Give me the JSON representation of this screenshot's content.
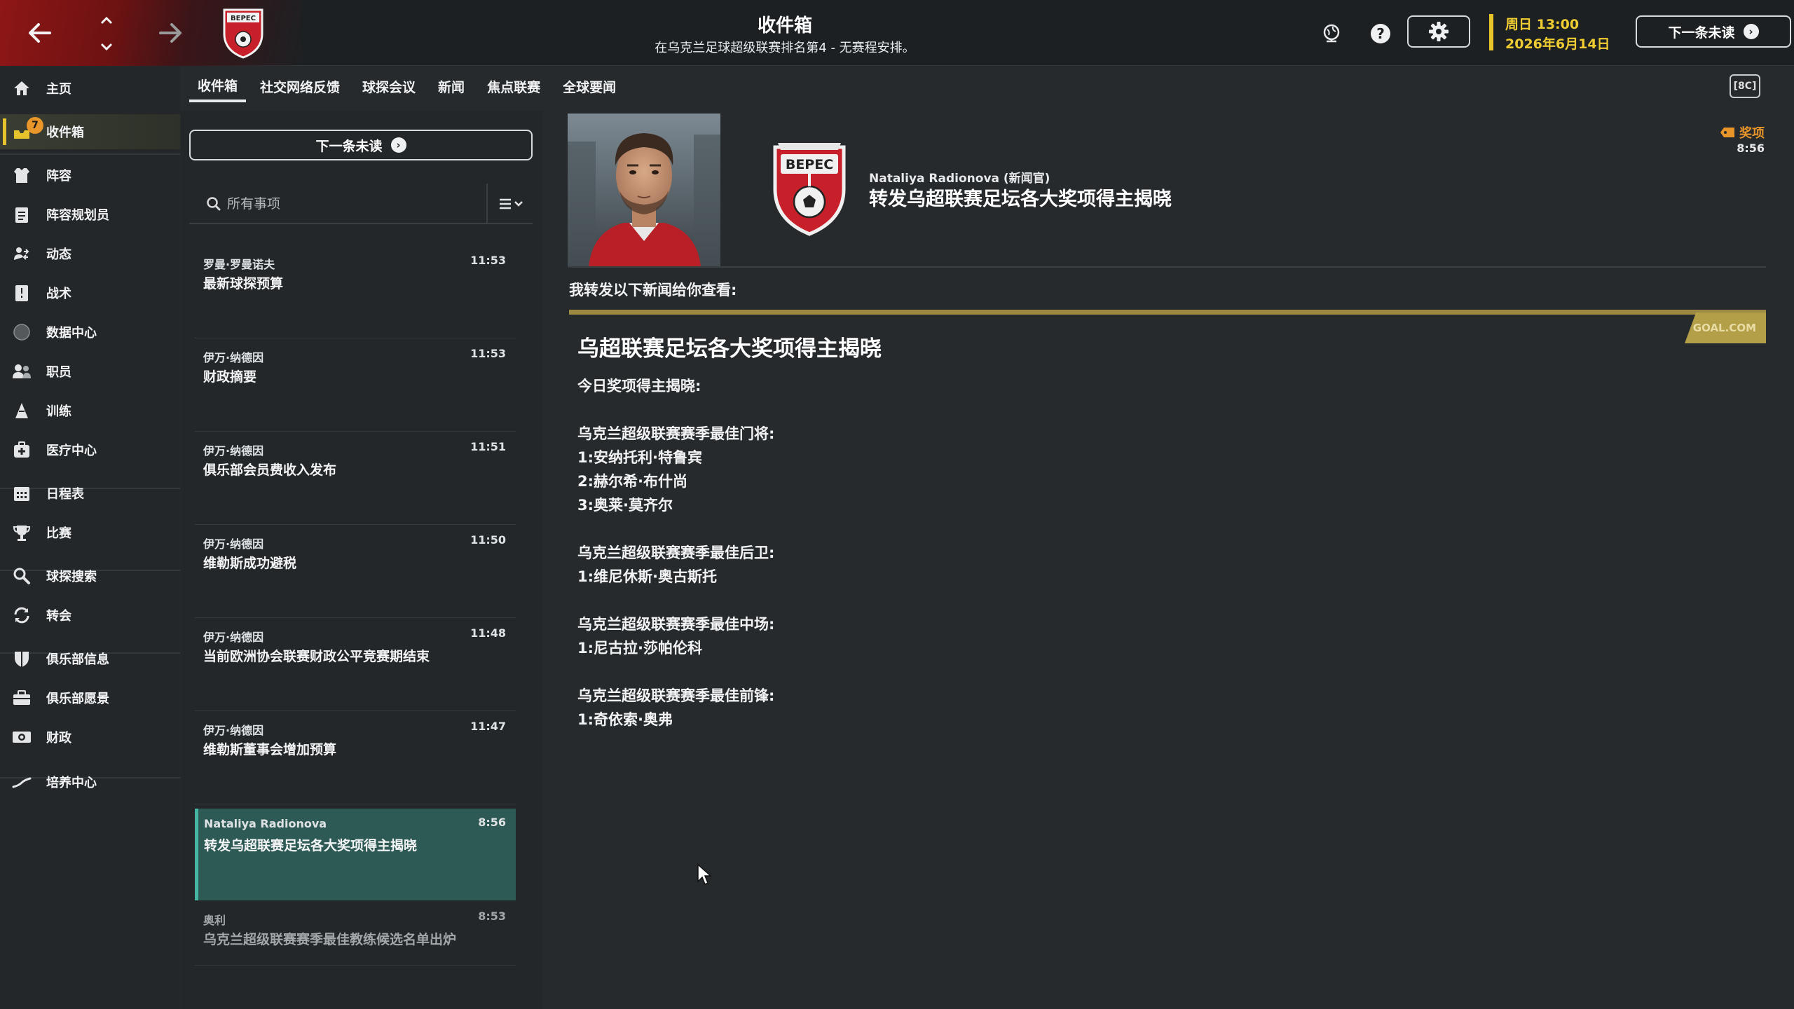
{
  "topbar": {
    "title": "收件箱",
    "subtitle": "在乌克兰足球超级联赛排名第4 - 无赛程安排。",
    "date_day": "周日 13:00",
    "date_full": "2026年6月14日",
    "next_unread": "下一条未读",
    "icons": [
      "back-arrow-icon",
      "up-arrow-icon",
      "down-arrow-icon",
      "forward-arrow-icon",
      "club-badge",
      "world-icon",
      "help-icon",
      "gear-icon"
    ]
  },
  "sidebar": {
    "inbox_badge": "7",
    "items": [
      {
        "label": "主页",
        "icon": "home-icon"
      },
      {
        "label": "收件箱",
        "icon": "inbox-icon"
      },
      {
        "label": "阵容",
        "icon": "squad-icon"
      },
      {
        "label": "阵容规划员",
        "icon": "clipboard-icon"
      },
      {
        "label": "动态",
        "icon": "dynamics-icon"
      },
      {
        "label": "战术",
        "icon": "tactics-icon"
      },
      {
        "label": "数据中心",
        "icon": "data-hub-icon"
      },
      {
        "label": "职员",
        "icon": "staff-icon"
      },
      {
        "label": "训练",
        "icon": "training-icon"
      },
      {
        "label": "医疗中心",
        "icon": "medical-icon"
      },
      {
        "label": "日程表",
        "icon": "calendar-icon"
      },
      {
        "label": "比赛",
        "icon": "trophy-icon"
      },
      {
        "label": "球探搜索",
        "icon": "search-icon"
      },
      {
        "label": "转会",
        "icon": "transfer-icon"
      },
      {
        "label": "俱乐部信息",
        "icon": "shield-icon"
      },
      {
        "label": "俱乐部愿景",
        "icon": "briefcase-icon"
      },
      {
        "label": "财政",
        "icon": "money-icon"
      },
      {
        "label": "培养中心",
        "icon": "development-icon"
      }
    ]
  },
  "tabs": [
    "收件箱",
    "社交网络反馈",
    "球探会议",
    "新闻",
    "焦点联赛",
    "全球要闻"
  ],
  "list": {
    "next_unread": "下一条未读",
    "search_placeholder": "所有事项",
    "messages": [
      {
        "sender": "罗曼·罗曼诺夫",
        "time": "11:53",
        "subject": "最新球探预算"
      },
      {
        "sender": "伊万·纳德因",
        "time": "11:53",
        "subject": "财政摘要"
      },
      {
        "sender": "伊万·纳德因",
        "time": "11:51",
        "subject": "俱乐部会员费收入发布"
      },
      {
        "sender": "伊万·纳德因",
        "time": "11:50",
        "subject": "维勒斯成功避税"
      },
      {
        "sender": "伊万·纳德因",
        "time": "11:48",
        "subject": "当前欧洲协会联赛财政公平竞赛期结束"
      },
      {
        "sender": "伊万·纳德因",
        "time": "11:47",
        "subject": "维勒斯董事会增加预算"
      },
      {
        "sender": "Nataliya Radionova",
        "time": "8:56",
        "subject": "转发乌超联赛足坛各大奖项得主揭晓"
      },
      {
        "sender": "奥利",
        "time": "8:53",
        "subject": "乌克兰超级联赛赛季最佳教练候选名单出炉"
      }
    ]
  },
  "message": {
    "from": "Nataliya Radionova (新闻官)",
    "title": "转发乌超联赛足坛各大奖项得主揭晓",
    "tag": "奖项",
    "time": "8:56",
    "forward_note": "我转发以下新闻给你查看:",
    "source": "GOAL.COM",
    "article_title": "乌超联赛足坛各大奖项得主揭晓",
    "article_lines": [
      "今日奖项得主揭晓:",
      "",
      "乌克兰超级联赛赛季最佳门将:",
      "1:安纳托利·特鲁宾",
      "2:赫尔希·布什尚",
      "3:奥莱·莫齐尔",
      "",
      "乌克兰超级联赛赛季最佳后卫:",
      "1:维尼休斯·奥古斯托",
      "",
      "乌克兰超级联赛赛季最佳中场:",
      "1:尼古拉·莎帕伦科",
      "",
      "乌克兰超级联赛赛季最佳前锋:",
      "1:奇依索·奥弗"
    ],
    "badge_text": "ВЕРЕС"
  },
  "colors": {
    "accent_yellow": "#e6c22c",
    "selected_row": "#2e5a55",
    "club_red": "#c8202a",
    "tag_orange": "#e8952a"
  }
}
